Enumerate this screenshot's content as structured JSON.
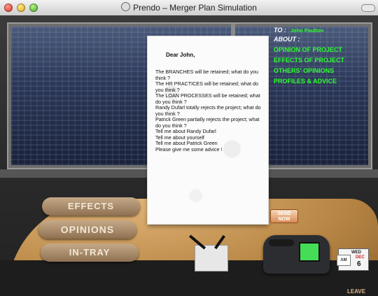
{
  "window": {
    "title": "Prendo – Merger Plan Simulation"
  },
  "message": {
    "to_label": "TO :",
    "to_name": "John Paulton",
    "about_label": "ABOUT :",
    "about_items": [
      {
        "label": "OPINION OF PROJECT"
      },
      {
        "label": "EFFECTS OF PROJECT"
      },
      {
        "label": "OTHERS' OPINIONS"
      },
      {
        "label": "PROFILES & ADVICE"
      }
    ]
  },
  "letter": {
    "greeting": "Dear John,",
    "lines": [
      "The BRANCHES will be retained; what do you think ?",
      "The HR PRACTICES will be retained; what do you think ?",
      "The LOAN PROCESSES will be retained; what do you think ?",
      "Randy Dufarl totally rejects the project; what do you think ?",
      "Patrick Green partially rejects the project; what do you think ?",
      "Tell me about Randy Dufarl",
      "Tell me about yourself",
      "Tell me about Patrick Green",
      "Please give me some advice !"
    ]
  },
  "buttons": {
    "effects": "EFFECTS",
    "opinions": "OPINIONS",
    "intray": "IN-TRAY",
    "send_line1": "SEND",
    "send_line2": "NOW",
    "leave": "LEAVE"
  },
  "calendar": {
    "ampm": "AM",
    "day": "WED",
    "month": "DEC",
    "date": "6"
  }
}
